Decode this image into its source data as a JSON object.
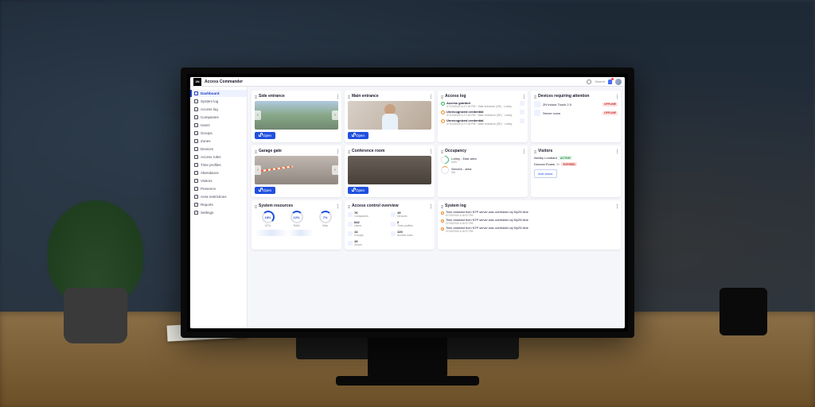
{
  "app": {
    "logo": "2N",
    "title": "Access Commander",
    "search_placeholder": "Search"
  },
  "sidebar": {
    "items": [
      {
        "label": "Dashboard"
      },
      {
        "label": "System log"
      },
      {
        "label": "Access log"
      },
      {
        "label": "Companies"
      },
      {
        "label": "Users"
      },
      {
        "label": "Groups"
      },
      {
        "label": "Zones"
      },
      {
        "label": "Devices"
      },
      {
        "label": "Access rules"
      },
      {
        "label": "Time profiles"
      },
      {
        "label": "Attendance"
      },
      {
        "label": "Visitors"
      },
      {
        "label": "Presence"
      },
      {
        "label": "Area restrictions"
      },
      {
        "label": "Reports"
      },
      {
        "label": "Settings"
      }
    ]
  },
  "cameras": {
    "side": {
      "title": "Side entrance",
      "open": "Open"
    },
    "main": {
      "title": "Main entrance",
      "open": "Open"
    },
    "garage": {
      "title": "Garage gate",
      "open": "Open"
    },
    "conf": {
      "title": "Conference room",
      "open": "Open"
    }
  },
  "access_log": {
    "title": "Access log",
    "items": [
      {
        "title": "Access granted",
        "sub": "07/13/2024 4:27:16 PM · Side entrance (SE) · Lobby"
      },
      {
        "title": "Unrecognized credential",
        "sub": "07/13/2024 4:27:16 PM · Main entrance (SE) · Lobby"
      },
      {
        "title": "Unrecognized credential",
        "sub": "07/13/2024 4:27:16 PM · Main entrance (SE) · Lobby"
      }
    ]
  },
  "devices_attention": {
    "title": "Devices requiring attention",
    "items": [
      {
        "name": "2N Indoor Touch 2.0",
        "badge": "OFFLINE"
      },
      {
        "name": "Server room",
        "badge": "OFFLINE"
      }
    ]
  },
  "occupancy": {
    "title": "Occupancy",
    "items": [
      {
        "name": "Lobby - East area",
        "val": "4/20"
      },
      {
        "name": "Servers - area",
        "val": "4/5"
      }
    ]
  },
  "visitors": {
    "title": "Visitors",
    "items": [
      {
        "name": "Ashley Lombard",
        "badge": "ACTIVE"
      },
      {
        "name": "Duncan Evans",
        "sub": "2h",
        "badge": "EXPIRED"
      }
    ],
    "add": "Add visitor"
  },
  "system_resources": {
    "title": "System resources",
    "gauges": [
      {
        "val": "18%",
        "label": "CPU"
      },
      {
        "val": "12%",
        "label": "RAM"
      },
      {
        "val": "7%",
        "label": "Disk"
      }
    ]
  },
  "access_overview": {
    "title": "Access control overview",
    "stats": [
      {
        "val": "76",
        "label": "Companies"
      },
      {
        "val": "19",
        "label": "Devices"
      },
      {
        "val": "642",
        "label": "Users"
      },
      {
        "val": "2",
        "label": "Time profiles"
      },
      {
        "val": "14",
        "label": "Groups"
      },
      {
        "val": "120",
        "label": "Access rules"
      },
      {
        "val": "19",
        "label": "Zones"
      },
      {
        "val": ""
      }
    ]
  },
  "system_log": {
    "title": "System log",
    "items": [
      {
        "msg": "Time obtained from NTP server was overridden by My2N time",
        "sub": "07/13/2024 4:16:27 PM"
      },
      {
        "msg": "Time obtained from NTP server was overridden by My2N time",
        "sub": "07/13/2024 4:16:27 PM"
      },
      {
        "msg": "Time obtained from NTP server was overridden by My2N time",
        "sub": "07/13/2024 4:16:27 PM"
      }
    ]
  }
}
